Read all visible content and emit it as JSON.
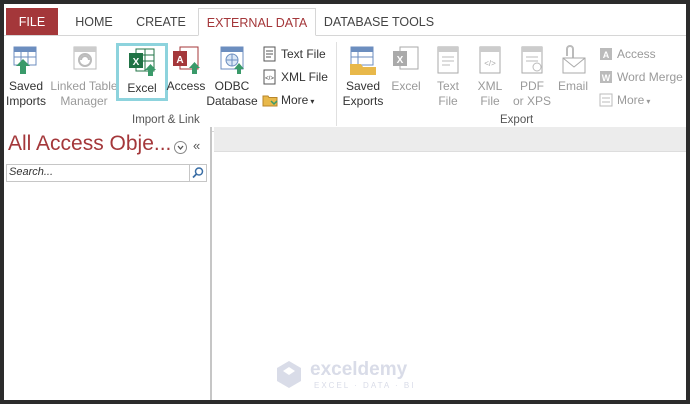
{
  "tabs": {
    "file": "FILE",
    "home": "HOME",
    "create": "CREATE",
    "external_data": "EXTERNAL DATA",
    "database_tools": "DATABASE TOOLS"
  },
  "import_link": {
    "group_label": "Import & Link",
    "saved_imports": [
      "Saved",
      "Imports"
    ],
    "linked_table_manager": [
      "Linked Table",
      "Manager"
    ],
    "excel": "Excel",
    "access": "Access",
    "odbc": [
      "ODBC",
      "Database"
    ],
    "text_file": "Text File",
    "xml_file": "XML File",
    "more": "More"
  },
  "export": {
    "group_label": "Export",
    "saved_exports": [
      "Saved",
      "Exports"
    ],
    "excel": "Excel",
    "text_file": [
      "Text",
      "File"
    ],
    "xml_file": [
      "XML",
      "File"
    ],
    "pdf_xps": [
      "PDF",
      "or XPS"
    ],
    "email": "Email",
    "access": "Access",
    "word_merge": "Word Merge",
    "more": "More"
  },
  "nav_pane": {
    "title": "All Access Obje...",
    "search_placeholder": "Search..."
  },
  "watermark": {
    "name": "exceldemy",
    "tagline": "EXCEL · DATA · BI"
  },
  "colors": {
    "accent": "#a4373a",
    "highlight": "#8dd3dd"
  }
}
